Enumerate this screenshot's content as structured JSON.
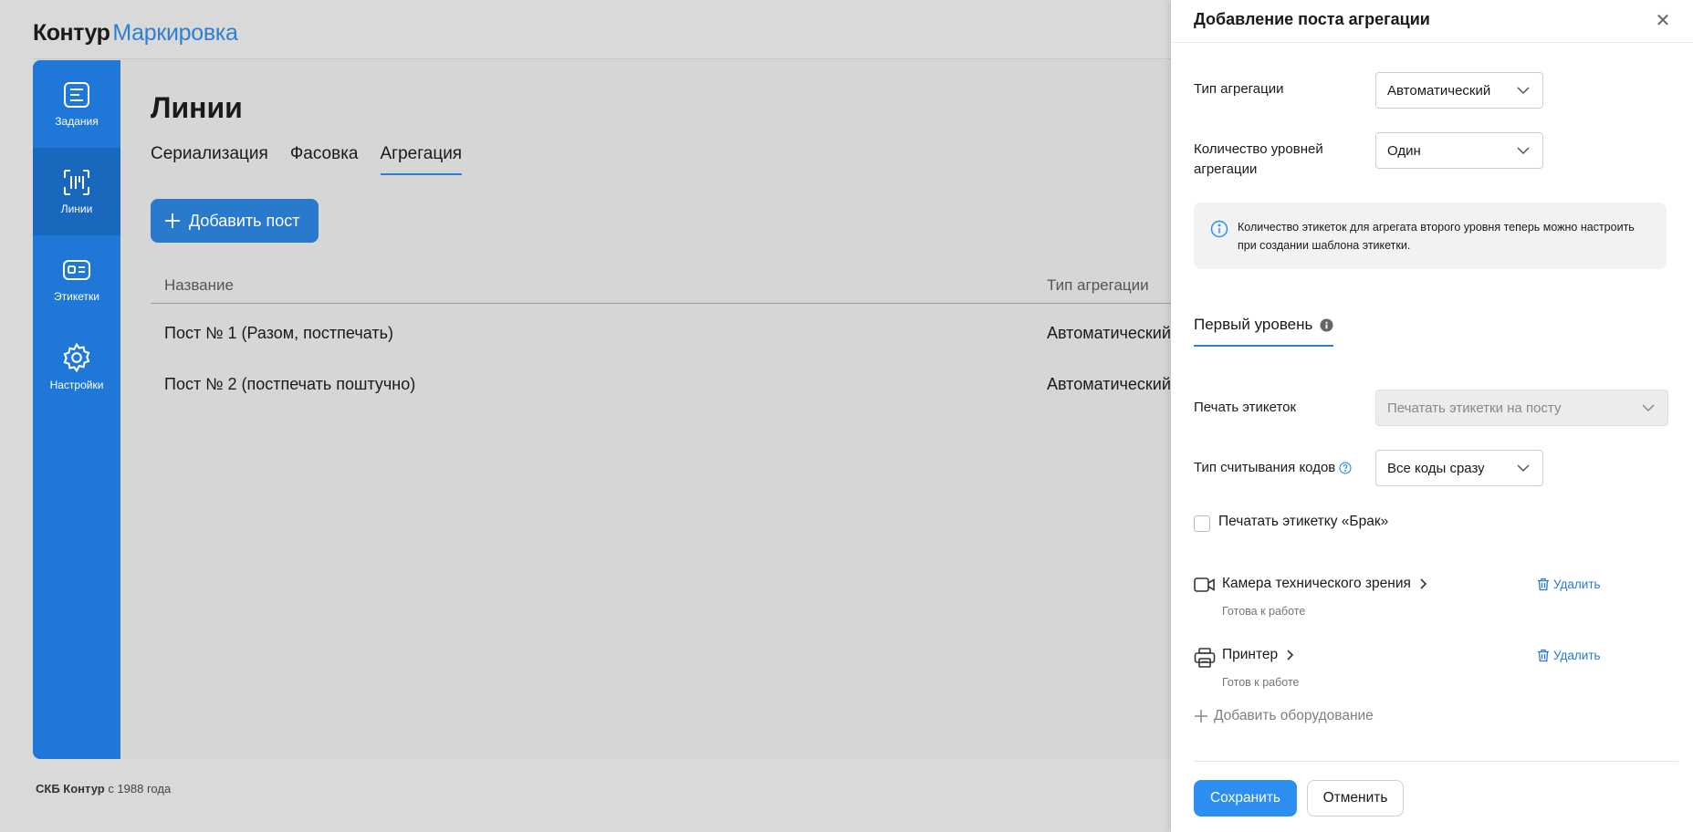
{
  "app": {
    "brand_first": "Контур",
    "brand_second": "Маркировка"
  },
  "sidebar": {
    "items": [
      {
        "label": "Задания",
        "icon": "tasks-icon"
      },
      {
        "label": "Линии",
        "icon": "lines-icon",
        "active": true
      },
      {
        "label": "Этикетки",
        "icon": "labels-icon"
      },
      {
        "label": "Настройки",
        "icon": "settings-icon"
      }
    ]
  },
  "main": {
    "title": "Линии",
    "tabs": [
      {
        "label": "Сериализация"
      },
      {
        "label": "Фасовка"
      },
      {
        "label": "Агрегация",
        "active": true
      }
    ],
    "add_button": "Добавить пост",
    "table": {
      "columns": [
        "Название",
        "Тип агрегации"
      ],
      "rows": [
        {
          "name": "Пост № 1 (Разом, постпечать)",
          "type": "Автоматический"
        },
        {
          "name": "Пост № 2 (постпечать поштучно)",
          "type": "Автоматический"
        }
      ]
    }
  },
  "footer": {
    "company": "СКБ Контур",
    "since": "с 1988 года"
  },
  "panel": {
    "title": "Добавление поста агрегации",
    "aggregation_type": {
      "label": "Тип агрегации",
      "value": "Автоматический"
    },
    "levels_count": {
      "label": "Количество уровней агрегации",
      "value": "Один"
    },
    "info": "Количество этикеток для агрегата второго уровня теперь можно настроить при создании шаблона этикетки.",
    "level_tab": "Первый уровень",
    "label_print": {
      "label": "Печать этикеток",
      "value": "Печатать этикетки на посту"
    },
    "read_type": {
      "label": "Тип считывания кодов",
      "value": "Все коды сразу"
    },
    "defect_checkbox": {
      "label": "Печатать этикетку «Брак»",
      "checked": false
    },
    "equipment": [
      {
        "name": "Камера технического зрения",
        "status": "Готова к работе",
        "delete": "Удалить",
        "icon": "camera-icon"
      },
      {
        "name": "Принтер",
        "status": "Готов к работе",
        "delete": "Удалить",
        "icon": "printer-icon"
      }
    ],
    "add_equipment": "Добавить оборудование",
    "save": "Сохранить",
    "cancel": "Отменить"
  },
  "colors": {
    "accent": "#2b8ef0",
    "sidebar": "#1f78d7",
    "link": "#2979cc"
  }
}
